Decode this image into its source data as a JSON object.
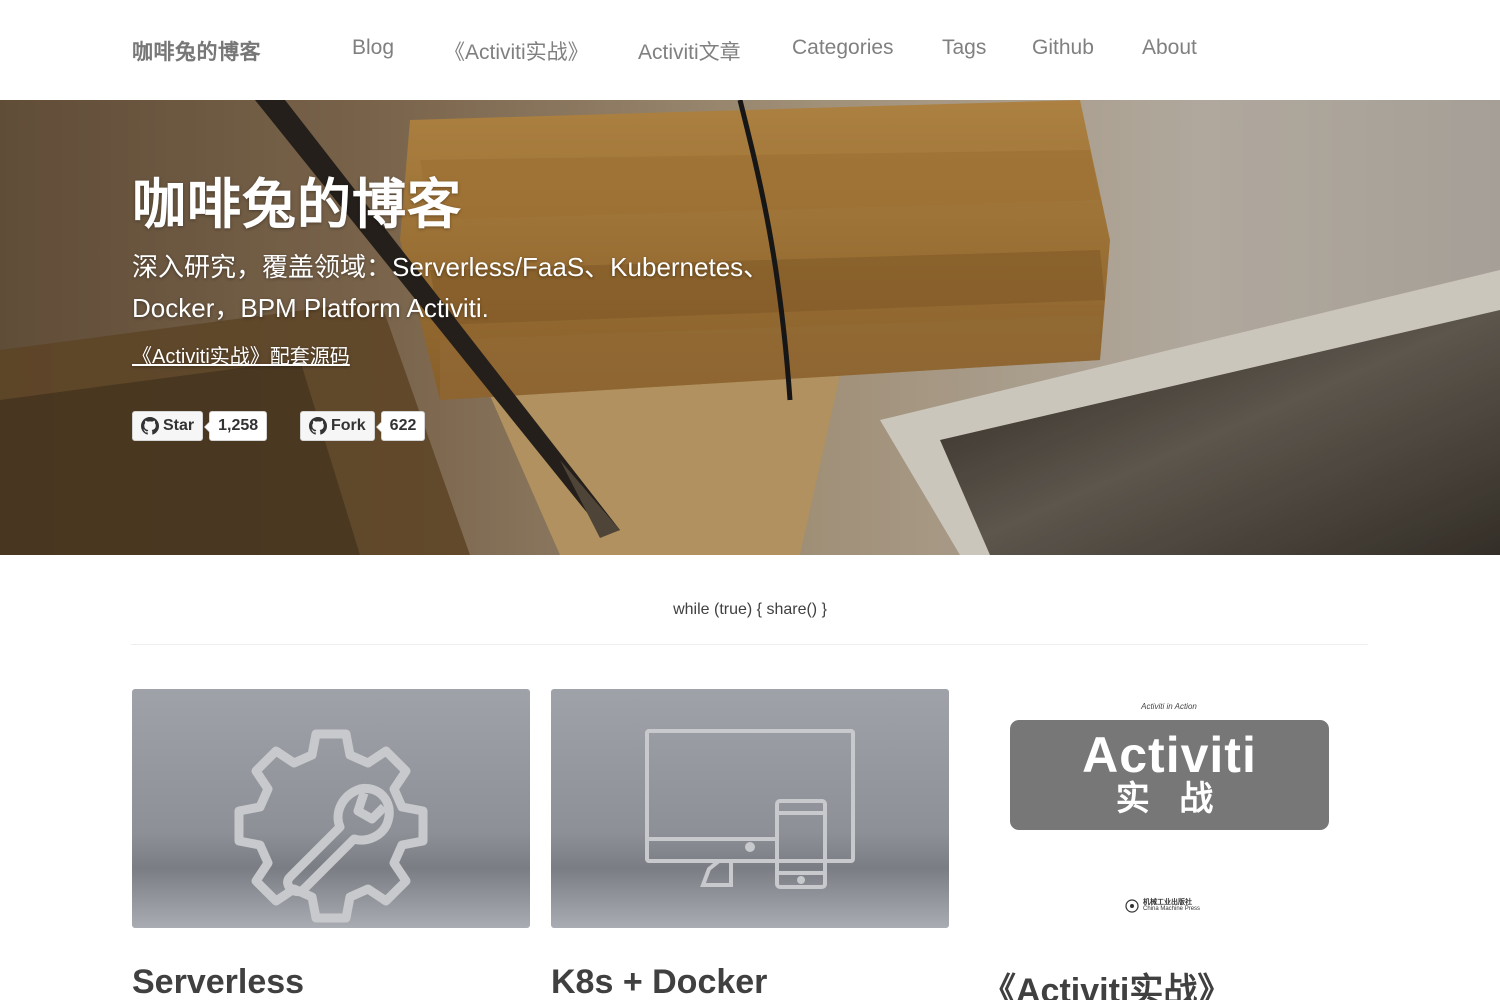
{
  "navbar": {
    "brand": "咖啡兔的博客",
    "items": [
      {
        "label": "Blog"
      },
      {
        "label": "《Activiti实战》"
      },
      {
        "label": "Activiti文章"
      },
      {
        "label": "Categories"
      },
      {
        "label": "Tags"
      },
      {
        "label": "Github"
      },
      {
        "label": "About"
      }
    ]
  },
  "hero": {
    "title": "咖啡兔的博客",
    "subtitle": "深入研究，覆盖领域：Serverless/FaaS、Kubernetes、Docker，BPM Platform Activiti.",
    "link": "《Activiti实战》配套源码",
    "github": {
      "star_label": "Star",
      "star_count": "1,258",
      "fork_label": "Fork",
      "fork_count": "622"
    }
  },
  "motto": "while (true) { share() }",
  "cards": [
    {
      "title": "Serverless",
      "icon": "gear-wrench-icon"
    },
    {
      "title": "K8s + Docker",
      "icon": "monitor-phone-icon"
    },
    {
      "title": "《Activiti实战》",
      "icon": "book-cover"
    }
  ],
  "book_cover": {
    "top_text": "Activiti in Action",
    "name": "Activiti",
    "sub": "实 战",
    "publisher_cn": "机械工业出版社",
    "publisher_en": "China Machine Press"
  },
  "colors": {
    "nav_text": "#808080",
    "brand": "#777777",
    "body_text": "#404040",
    "card_bg": "#9a9ca1",
    "book_box": "#777777"
  }
}
